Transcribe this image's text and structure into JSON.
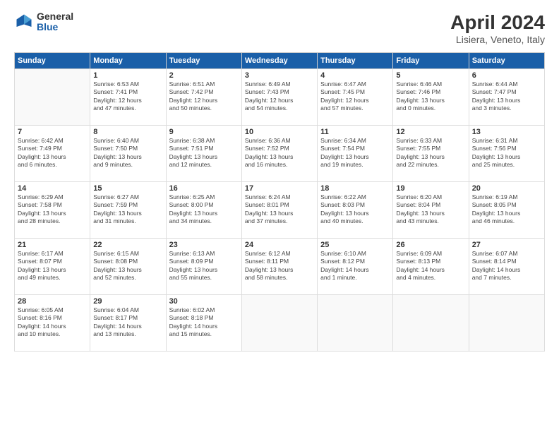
{
  "logo": {
    "general": "General",
    "blue": "Blue"
  },
  "title": "April 2024",
  "subtitle": "Lisiera, Veneto, Italy",
  "weekdays": [
    "Sunday",
    "Monday",
    "Tuesday",
    "Wednesday",
    "Thursday",
    "Friday",
    "Saturday"
  ],
  "weeks": [
    [
      {
        "day": null,
        "info": ""
      },
      {
        "day": "1",
        "info": "Sunrise: 6:53 AM\nSunset: 7:41 PM\nDaylight: 12 hours\nand 47 minutes."
      },
      {
        "day": "2",
        "info": "Sunrise: 6:51 AM\nSunset: 7:42 PM\nDaylight: 12 hours\nand 50 minutes."
      },
      {
        "day": "3",
        "info": "Sunrise: 6:49 AM\nSunset: 7:43 PM\nDaylight: 12 hours\nand 54 minutes."
      },
      {
        "day": "4",
        "info": "Sunrise: 6:47 AM\nSunset: 7:45 PM\nDaylight: 12 hours\nand 57 minutes."
      },
      {
        "day": "5",
        "info": "Sunrise: 6:46 AM\nSunset: 7:46 PM\nDaylight: 13 hours\nand 0 minutes."
      },
      {
        "day": "6",
        "info": "Sunrise: 6:44 AM\nSunset: 7:47 PM\nDaylight: 13 hours\nand 3 minutes."
      }
    ],
    [
      {
        "day": "7",
        "info": "Sunrise: 6:42 AM\nSunset: 7:49 PM\nDaylight: 13 hours\nand 6 minutes."
      },
      {
        "day": "8",
        "info": "Sunrise: 6:40 AM\nSunset: 7:50 PM\nDaylight: 13 hours\nand 9 minutes."
      },
      {
        "day": "9",
        "info": "Sunrise: 6:38 AM\nSunset: 7:51 PM\nDaylight: 13 hours\nand 12 minutes."
      },
      {
        "day": "10",
        "info": "Sunrise: 6:36 AM\nSunset: 7:52 PM\nDaylight: 13 hours\nand 16 minutes."
      },
      {
        "day": "11",
        "info": "Sunrise: 6:34 AM\nSunset: 7:54 PM\nDaylight: 13 hours\nand 19 minutes."
      },
      {
        "day": "12",
        "info": "Sunrise: 6:33 AM\nSunset: 7:55 PM\nDaylight: 13 hours\nand 22 minutes."
      },
      {
        "day": "13",
        "info": "Sunrise: 6:31 AM\nSunset: 7:56 PM\nDaylight: 13 hours\nand 25 minutes."
      }
    ],
    [
      {
        "day": "14",
        "info": "Sunrise: 6:29 AM\nSunset: 7:58 PM\nDaylight: 13 hours\nand 28 minutes."
      },
      {
        "day": "15",
        "info": "Sunrise: 6:27 AM\nSunset: 7:59 PM\nDaylight: 13 hours\nand 31 minutes."
      },
      {
        "day": "16",
        "info": "Sunrise: 6:25 AM\nSunset: 8:00 PM\nDaylight: 13 hours\nand 34 minutes."
      },
      {
        "day": "17",
        "info": "Sunrise: 6:24 AM\nSunset: 8:01 PM\nDaylight: 13 hours\nand 37 minutes."
      },
      {
        "day": "18",
        "info": "Sunrise: 6:22 AM\nSunset: 8:03 PM\nDaylight: 13 hours\nand 40 minutes."
      },
      {
        "day": "19",
        "info": "Sunrise: 6:20 AM\nSunset: 8:04 PM\nDaylight: 13 hours\nand 43 minutes."
      },
      {
        "day": "20",
        "info": "Sunrise: 6:19 AM\nSunset: 8:05 PM\nDaylight: 13 hours\nand 46 minutes."
      }
    ],
    [
      {
        "day": "21",
        "info": "Sunrise: 6:17 AM\nSunset: 8:07 PM\nDaylight: 13 hours\nand 49 minutes."
      },
      {
        "day": "22",
        "info": "Sunrise: 6:15 AM\nSunset: 8:08 PM\nDaylight: 13 hours\nand 52 minutes."
      },
      {
        "day": "23",
        "info": "Sunrise: 6:13 AM\nSunset: 8:09 PM\nDaylight: 13 hours\nand 55 minutes."
      },
      {
        "day": "24",
        "info": "Sunrise: 6:12 AM\nSunset: 8:11 PM\nDaylight: 13 hours\nand 58 minutes."
      },
      {
        "day": "25",
        "info": "Sunrise: 6:10 AM\nSunset: 8:12 PM\nDaylight: 14 hours\nand 1 minute."
      },
      {
        "day": "26",
        "info": "Sunrise: 6:09 AM\nSunset: 8:13 PM\nDaylight: 14 hours\nand 4 minutes."
      },
      {
        "day": "27",
        "info": "Sunrise: 6:07 AM\nSunset: 8:14 PM\nDaylight: 14 hours\nand 7 minutes."
      }
    ],
    [
      {
        "day": "28",
        "info": "Sunrise: 6:05 AM\nSunset: 8:16 PM\nDaylight: 14 hours\nand 10 minutes."
      },
      {
        "day": "29",
        "info": "Sunrise: 6:04 AM\nSunset: 8:17 PM\nDaylight: 14 hours\nand 13 minutes."
      },
      {
        "day": "30",
        "info": "Sunrise: 6:02 AM\nSunset: 8:18 PM\nDaylight: 14 hours\nand 15 minutes."
      },
      {
        "day": null,
        "info": ""
      },
      {
        "day": null,
        "info": ""
      },
      {
        "day": null,
        "info": ""
      },
      {
        "day": null,
        "info": ""
      }
    ]
  ]
}
